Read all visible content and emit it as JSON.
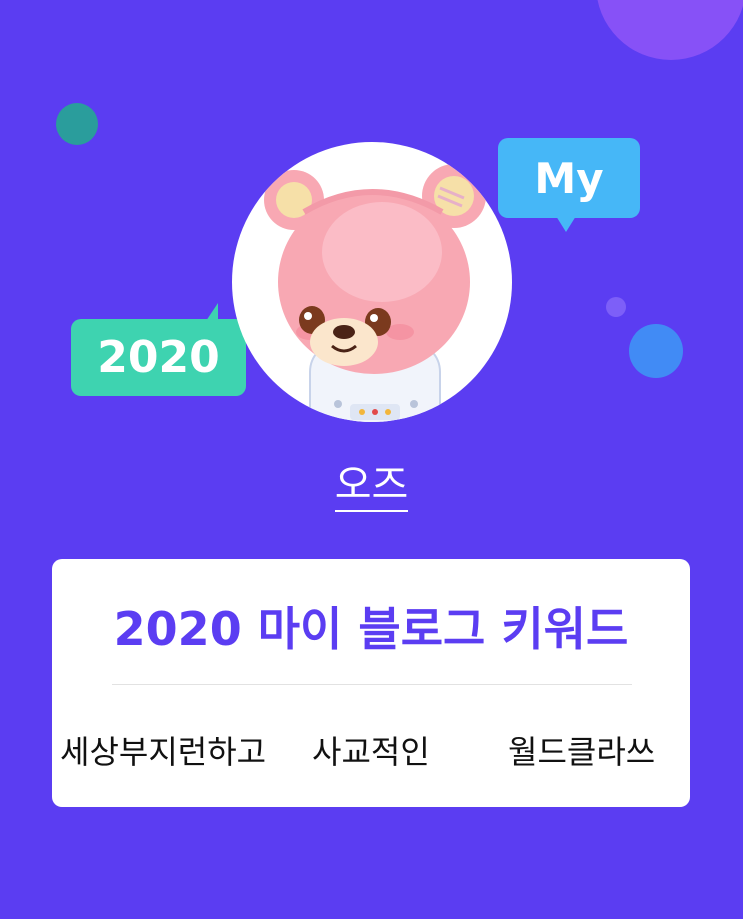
{
  "bubbles": {
    "my_label": "My",
    "year_label": "2020"
  },
  "profile": {
    "name": "오즈"
  },
  "keyword_card": {
    "title": "2020 마이 블로그 키워드",
    "keywords": [
      "세상부지런하고",
      "사교적인",
      "월드클라쓰"
    ]
  },
  "colors": {
    "background": "#5b3df2",
    "title_accent": "#5b3df2",
    "my_bubble": "#46b7f7",
    "year_bubble": "#3ed3b0"
  }
}
